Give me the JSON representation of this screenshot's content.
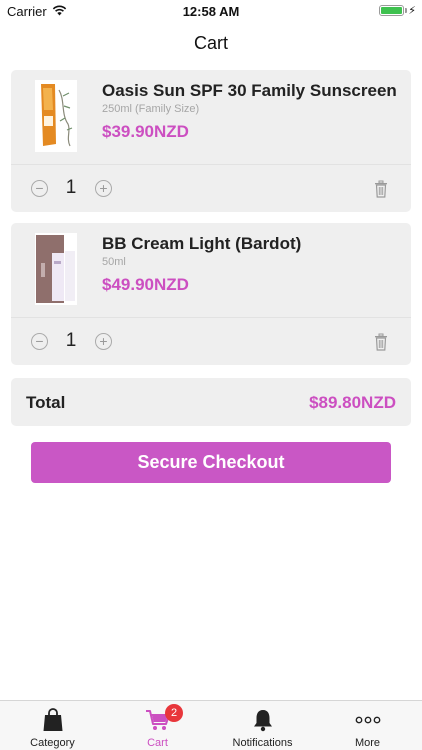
{
  "status_bar": {
    "carrier": "Carrier",
    "time": "12:58 AM",
    "battery_level": 1.0
  },
  "nav": {
    "title": "Cart"
  },
  "cart": {
    "items": [
      {
        "name": "Oasis Sun SPF 30 Family Sunscreen",
        "size": "250ml (Family Size)",
        "price": "$39.90NZD",
        "quantity": "1"
      },
      {
        "name": "BB Cream Light (Bardot)",
        "size": "50ml",
        "price": "$49.90NZD",
        "quantity": "1"
      }
    ],
    "stepper": {
      "decrease": "−",
      "increase": "+"
    }
  },
  "total": {
    "label": "Total",
    "value": "$89.80NZD"
  },
  "checkout": {
    "label": "Secure Checkout"
  },
  "tab_bar": {
    "tabs": [
      {
        "label": "Category",
        "icon": "bag-icon",
        "active": false
      },
      {
        "label": "Cart",
        "icon": "cart-icon",
        "active": true,
        "badge": "2"
      },
      {
        "label": "Notifications",
        "icon": "bell-icon",
        "active": false
      },
      {
        "label": "More",
        "icon": "more-icon",
        "active": false
      }
    ]
  },
  "colors": {
    "accent": "#cc4fc1",
    "checkout_button": "#c957c5",
    "card_background": "#efefef",
    "badge": "#e8363b",
    "battery": "#3ec14f"
  }
}
